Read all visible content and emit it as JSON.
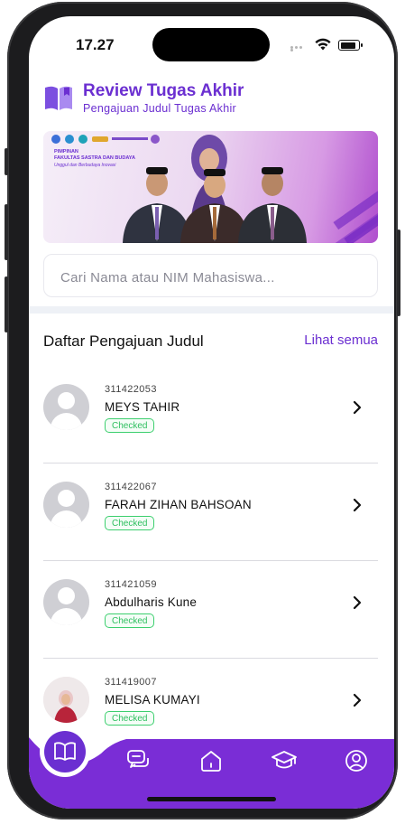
{
  "status_bar": {
    "time": "17.27"
  },
  "header": {
    "title": "Review Tugas Akhir",
    "subtitle": "Pengajuan Judul Tugas Akhir"
  },
  "banner": {
    "title_line1": "PIMPINAN",
    "title_line2": "FAKULTAS SASTRA DAN BUDAYA",
    "tagline": "Unggul dan Berbudaya Inovasi"
  },
  "search": {
    "placeholder": "Cari Nama atau NIM Mahasiswa..."
  },
  "section": {
    "title": "Daftar Pengajuan Judul",
    "see_all": "Lihat semua"
  },
  "submissions": [
    {
      "nim": "311422053",
      "name": "MEYS TAHIR",
      "status": "Checked"
    },
    {
      "nim": "311422067",
      "name": "FARAH ZIHAN BAHSOAN",
      "status": "Checked"
    },
    {
      "nim": "311421059",
      "name": "Abdulharis Kune",
      "status": "Checked"
    },
    {
      "nim": "311419007",
      "name": "MELISA KUMAYI",
      "status": "Checked"
    }
  ],
  "bottom_nav": {
    "items": [
      "book-open-icon",
      "chat-icon",
      "home-icon",
      "graduation-cap-icon",
      "profile-icon"
    ],
    "active": "book-open-icon"
  },
  "colors": {
    "accent": "#6b2fd1",
    "status_green": "#2ebf5f",
    "nav_background": "#7a2dd6"
  }
}
